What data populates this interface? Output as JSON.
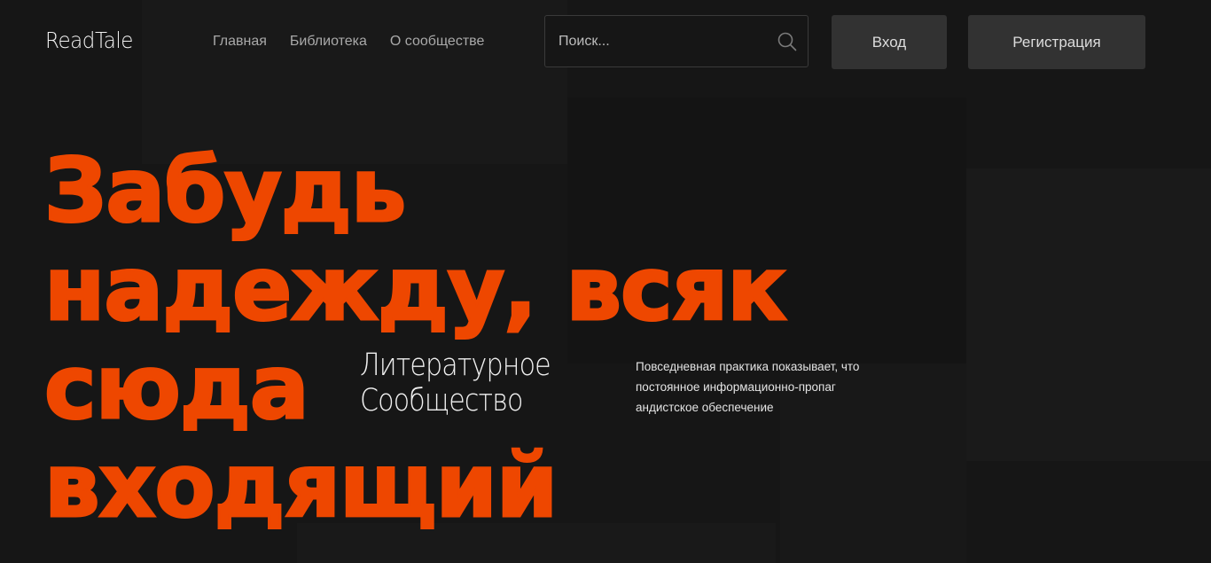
{
  "header": {
    "logo": "ReadTale",
    "nav": [
      {
        "label": "Главная"
      },
      {
        "label": "Библиотека"
      },
      {
        "label": "О сообществе"
      }
    ],
    "search": {
      "placeholder": "Поиск...",
      "icon": "search-icon"
    },
    "login_label": "Вход",
    "register_label": "Регистрация"
  },
  "hero": {
    "title_lines": [
      "Забудь",
      "надежду, всяк",
      "сюда",
      "входящий"
    ],
    "subtitle_lines": [
      "Литературное",
      "Сообщество"
    ],
    "description_lines": [
      "Повседневная практика показывает, что",
      "постоянное информационно-пропаг",
      "андистское обеспечение"
    ]
  },
  "colors": {
    "background": "#161616",
    "accent": "#ee4700",
    "button": "#323232"
  }
}
